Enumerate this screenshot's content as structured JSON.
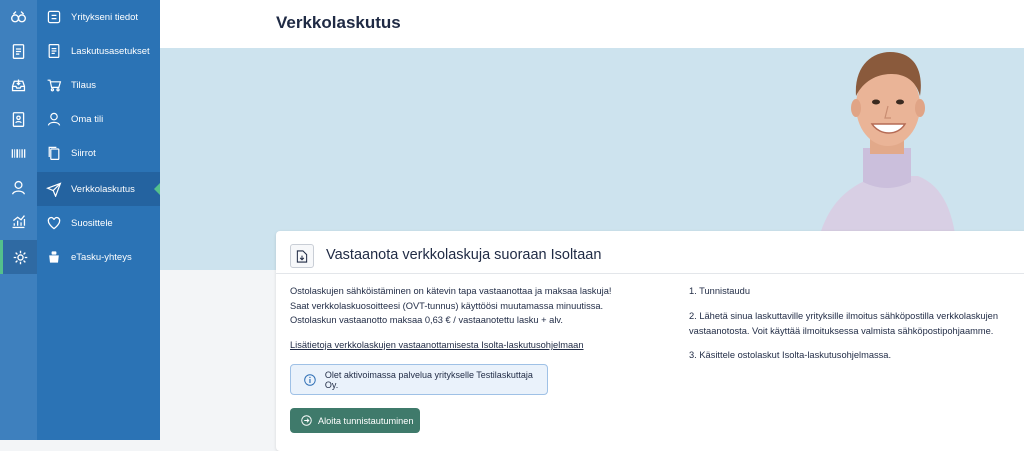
{
  "page_title": "Verkkolaskutus",
  "rail": {
    "icons": [
      "logo-icon",
      "document-icon",
      "inbox-icon",
      "contact-icon",
      "barcode-icon",
      "user-icon",
      "chart-icon",
      "gear-icon"
    ]
  },
  "sidebar": {
    "items": [
      {
        "label": "Yritykseni tiedot",
        "icon": "building-icon"
      },
      {
        "label": "Laskutusasetukset",
        "icon": "invoice-icon"
      },
      {
        "label": "Tilaus",
        "icon": "cart-icon"
      },
      {
        "label": "Oma tili",
        "icon": "user-icon"
      },
      {
        "label": "Siirrot",
        "icon": "copy-icon"
      },
      {
        "label": "Verkkolaskutus",
        "icon": "send-icon"
      },
      {
        "label": "Suosittele",
        "icon": "heart-icon"
      },
      {
        "label": "eTasku-yhteys",
        "icon": "bag-icon"
      }
    ],
    "active_index": 5
  },
  "card": {
    "title": "Vastaanota verkkolaskuja suoraan Isoltaan",
    "intro_line1": "Ostolaskujen sähköistäminen on kätevin tapa vastaanottaa ja maksaa laskuja!",
    "intro_line2": "Saat verkkolaskuosoitteesi (OVT-tunnus) käyttöösi muutamassa minuutissa.",
    "intro_line3": "Ostolaskun vastaanotto maksaa 0,63 € / vastaanotettu lasku + alv.",
    "link_text": "Lisätietoja verkkolaskujen vastaanottamisesta Isolta-laskutusohjelmaan",
    "info_text": "Olet aktivoimassa palvelua yritykselle Testilaskuttaja Oy.",
    "button_label": "Aloita tunnistautuminen",
    "step1": "1. Tunnistaudu",
    "step2_line1": "2. Lähetä sinua laskuttaville yrityksille ilmoitus sähköpostilla verkkolaskujen",
    "step2_line2": "vastaanotosta. Voit käyttää ilmoituksessa valmista sähköpostipohjaamme.",
    "step3": "3. Käsittele ostolaskut Isolta-laskutusohjelmassa."
  },
  "colors": {
    "rail_bg": "#3e80be",
    "sidebar_bg": "#2b73b5",
    "active_marker": "#54c08c",
    "hero_bg": "#cde3ee",
    "button_bg": "#3f7a6b",
    "info_bg": "#eaf2fb"
  }
}
